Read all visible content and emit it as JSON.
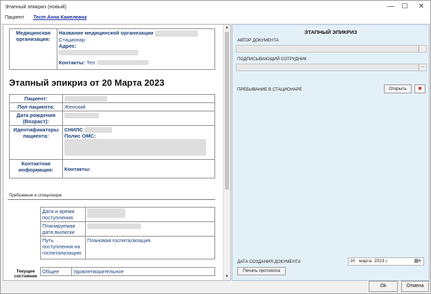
{
  "window": {
    "title": "Этапный эпикриз (новый)",
    "minimize_glyph": "—",
    "maximize_glyph": "☐",
    "close_glyph": "✕"
  },
  "patient": {
    "label": "Пациент",
    "name": "Тест Анна Камелевна"
  },
  "document": {
    "org_label": "Медицинская организация:",
    "org_name_label": "Название медицинской организации",
    "org_type": "Стационар",
    "address_label": "Адрес:",
    "contacts_label": "Контакты:",
    "contacts_value": "Тел",
    "heading": "Этапный эпикриз от 20 Марта 2023",
    "patient_label": "Пациент:",
    "sex_label": "Пол пациента:",
    "sex_value": "Женский",
    "birth_label": "Дата рождения (Возраст):",
    "ids_label": "Идентификаторы пациента:",
    "snils_label": "СНИЛС",
    "oms_label": "Полис ОМС:",
    "contact_info_label": "Контактная информация:",
    "contact_info_value": "Контакты:",
    "stay_section": "Пребывание в стационаре",
    "admission_label": "Дата и время поступления",
    "discharge_label": "Планируемая дата выписки",
    "route_label": "Путь поступления на госпитализацию",
    "route_value": "Плановая госпитализация",
    "condition_label": "Текущее состояние",
    "condition_type": "Общее",
    "condition_value": "Удовлетворительное"
  },
  "panel": {
    "title": "ЭТАПНЫЙ ЭПИКРИЗ",
    "author_label": "АВТОР ДОКУМЕНТА",
    "signer_label": "ПОДПИСЫВАЮЩИЙ СОТРУДНИК",
    "stay_label": "ПРЕБЫВАНИЕ В СТАЦИОНАРЕ",
    "open_button": "Открыть",
    "ellipsis": "...",
    "created_label": "ДАТА СОЗДАНИЯ ДОКУМЕНТА",
    "created_day": "20",
    "created_month": "марта",
    "created_year": "2023 г.",
    "print_button": "Печать протокола"
  },
  "footer": {
    "ok": "Ok",
    "cancel": "Отмена"
  }
}
